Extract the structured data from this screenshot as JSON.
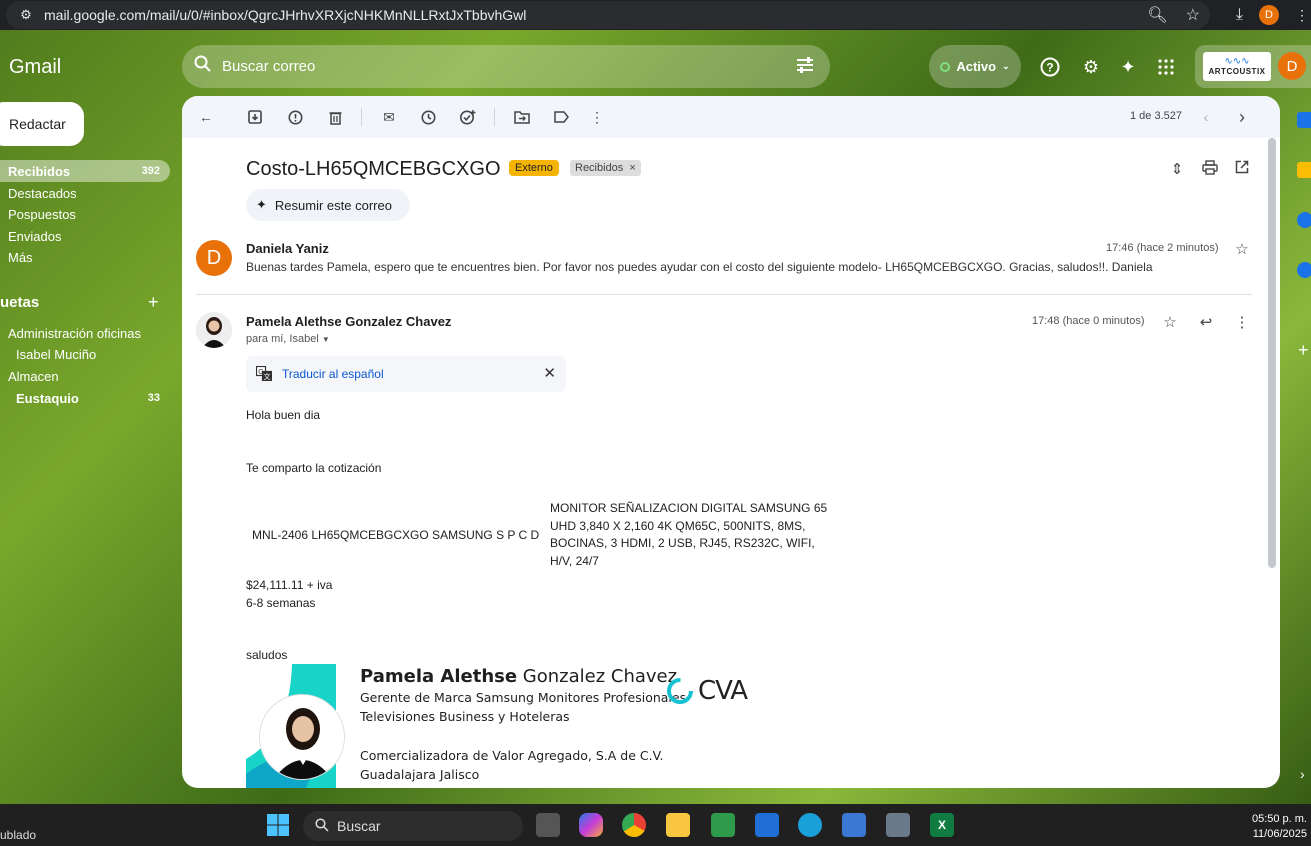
{
  "browser": {
    "url": "mail.google.com/mail/u/0/#inbox/QgrcJHrhvXRXjcNHKMnNLLRxtJxTbbvhGwl",
    "avatar_letter": "D"
  },
  "header": {
    "logo": "Gmail",
    "search_placeholder": "Buscar correo",
    "status": "Activo",
    "brand_text": "ARTCOUSTIX",
    "avatar_letter": "D"
  },
  "nav": {
    "compose": "Redactar",
    "items": [
      {
        "label": "Recibidos",
        "count": "392"
      },
      {
        "label": "Destacados",
        "count": ""
      },
      {
        "label": "Pospuestos",
        "count": ""
      },
      {
        "label": "Enviados",
        "count": ""
      },
      {
        "label": "Más",
        "count": ""
      }
    ],
    "labels_title": "uetas",
    "labels": [
      {
        "label": "Administración oficinas",
        "count": ""
      },
      {
        "label": "Isabel Muciño",
        "count": ""
      },
      {
        "label": "Almacen",
        "count": ""
      },
      {
        "label": "Eustaquio",
        "count": "33"
      }
    ]
  },
  "toolbar": {
    "pager": "1 de 3.527"
  },
  "email": {
    "subject": "Costo-LH65QMCEBGCXGO",
    "tag_external": "Externo",
    "tag_inbox": "Recibidos",
    "summarize": "Resumir este correo",
    "message1": {
      "avatar_letter": "D",
      "sender": "Daniela Yaniz",
      "time": "17:46 (hace 2 minutos)",
      "snippet": "Buenas tardes Pamela, espero que te encuentres bien. Por favor nos puedes ayudar con el costo del siguiente modelo- LH65QMCEBGCXGO. Gracias, saludos!!. Daniela"
    },
    "message2": {
      "sender": "Pamela Alethse Gonzalez Chavez",
      "time": "17:48 (hace 0 minutos)",
      "to": "para mí, Isabel",
      "translate": "Traducir al español",
      "greeting": "Hola buen dia",
      "intro": "Te comparto la cotización",
      "item_line": "MNL-2406  LH65QMCEBGCXGO  SAMSUNG  S P C D",
      "item_desc": "MONITOR SEÑALIZACION DIGITAL SAMSUNG 65 UHD 3,840 X 2,160 4K QM65C, 500NITS, 8MS, BOCINAS, 3 HDMI, 2 USB, RJ45, RS232C, WIFI, H/V, 24/7",
      "price": "$24,111.11 + iva",
      "delivery": "6-8 semanas",
      "closing": "saludos",
      "sig_first": "Pamela Alethse",
      "sig_last": " Gonzalez Chavez",
      "sig_title1": "Gerente de Marca Samsung Monitores Profesionales",
      "sig_title2": "Televisiones Business y Hoteleras",
      "sig_company": "Comercializadora de Valor Agregado, S.A de C.V.",
      "sig_city": "Guadalajara Jalisco",
      "sig_logo": "CVA"
    }
  },
  "taskbar": {
    "weather": "ublado",
    "search": "Buscar",
    "time": "05:50 p. m.",
    "date": "11/06/2025"
  }
}
